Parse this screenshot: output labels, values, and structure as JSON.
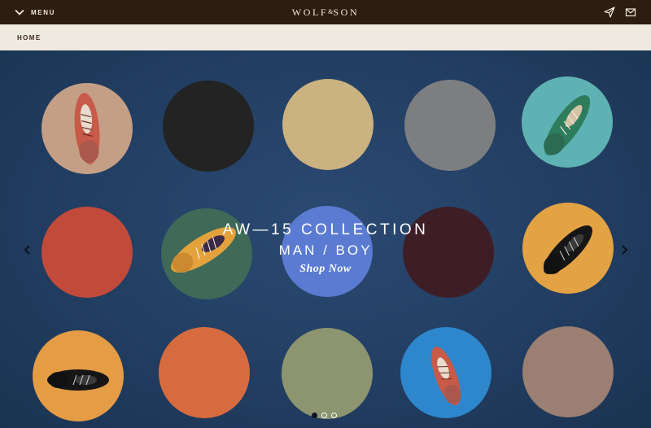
{
  "topbar": {
    "menu_label": "MENU",
    "brand_left": "WOLF",
    "brand_amp": "&",
    "brand_right": "SON",
    "icons": [
      "chevron-down-icon",
      "send-icon",
      "mail-icon"
    ]
  },
  "breadcrumb": {
    "home": "HOME"
  },
  "hero": {
    "title": "AW—15 COLLECTION",
    "subtitle": "MAN / BOY",
    "cta": "Shop Now",
    "slides_total": 3,
    "active_slide": 1
  },
  "colors": {
    "topbar": "#2c1d10",
    "breadcrumb_bg": "#efeae0",
    "hero_bg": "#233c5c",
    "disc_palette": [
      "#c49f86",
      "#232323",
      "#cbb281",
      "#7d7e80",
      "#5eb2b3",
      "#c24a3b",
      "#3f6a58",
      "#5b7bd2",
      "#3d1e26",
      "#e3a244",
      "#e49c45",
      "#d66b3f",
      "#8c9470",
      "#2e86cc",
      "#9a7f72"
    ]
  }
}
